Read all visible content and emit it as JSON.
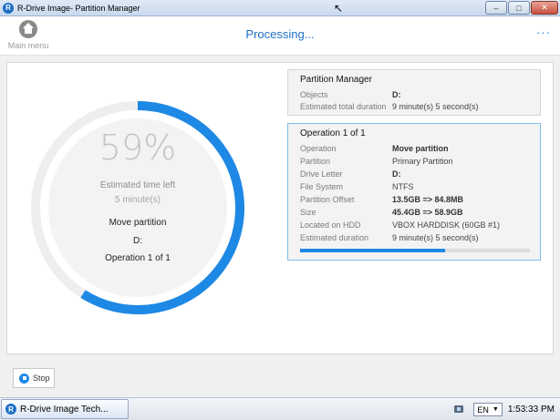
{
  "window": {
    "title": "R-Drive Image- Partition Manager",
    "icon": "r-drive-icon",
    "controls": [
      "minimize",
      "maximize",
      "close"
    ]
  },
  "header": {
    "main_menu_label": "Main menu",
    "title": "Processing...",
    "more_label": "···"
  },
  "progress": {
    "percent_text": "59%",
    "fraction": 0.59,
    "estimated_time_left_label": "Estimated time left",
    "estimated_time_left_value": "5 minute(s)",
    "operation_name": "Move partition",
    "drive": "D:",
    "operation_counter": "Operation 1 of 1"
  },
  "partition_manager_card": {
    "title": "Partition Manager",
    "rows": [
      {
        "key": "Objects",
        "value": "D:",
        "bold": true
      },
      {
        "key": "Estimated total duration",
        "value": "9 minute(s) 5 second(s)",
        "bold": false
      }
    ]
  },
  "operation_card": {
    "title": "Operation 1 of 1",
    "rows": [
      {
        "key": "Operation",
        "value": "Move partition",
        "bold": true
      },
      {
        "key": "Partition",
        "value": "Primary Partition",
        "bold": false
      },
      {
        "key": "Drive Letter",
        "value": "D:",
        "bold": true
      },
      {
        "key": "File System",
        "value": "NTFS",
        "bold": false
      },
      {
        "key": "Partition Offset",
        "value": "13.5GB => 84.8MB",
        "bold": true
      },
      {
        "key": "Size",
        "value": "45.4GB => 58.9GB",
        "bold": true
      },
      {
        "key": "Located on HDD",
        "value": "VBOX HARDDISK (60GB #1)",
        "bold": false
      },
      {
        "key": "Estimated duration",
        "value": "9 minute(s) 5 second(s)",
        "bold": false
      }
    ],
    "progress_fraction": 0.63
  },
  "bottom": {
    "stop_label": "Stop"
  },
  "taskbar": {
    "task_label": "R-Drive Image Tech...",
    "language": "EN",
    "time": "1:53:33 PM"
  },
  "colors": {
    "accent": "#1e88e5",
    "ring_track": "#eeeeee",
    "title_blue": "#1e6fc5"
  }
}
